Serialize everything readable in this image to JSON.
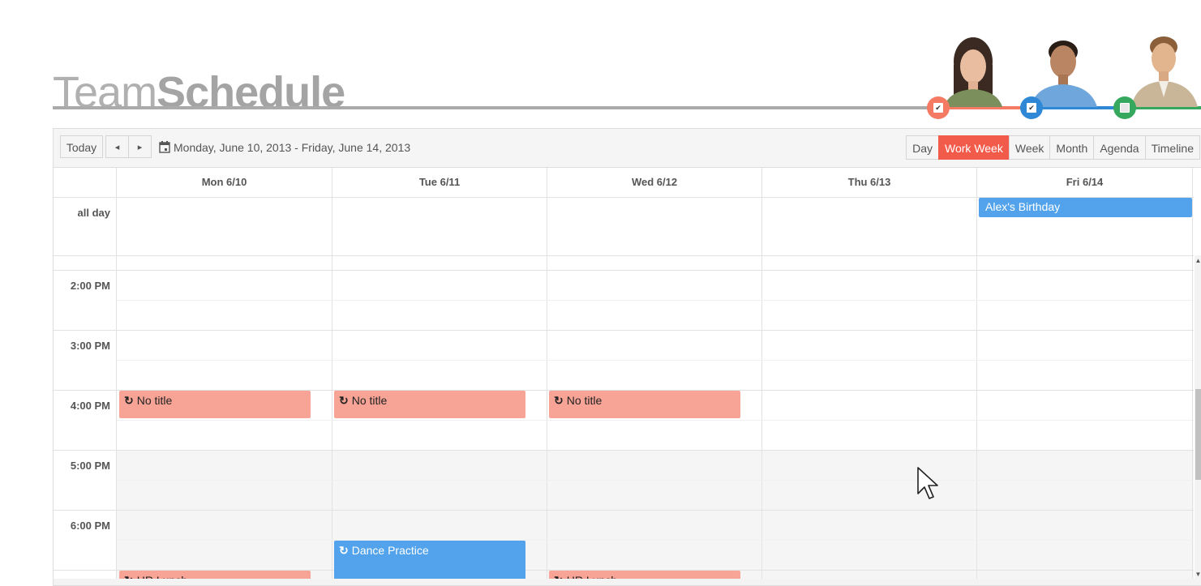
{
  "header": {
    "title_light": "Team",
    "title_bold": "Schedule"
  },
  "people": [
    {
      "name": "woman",
      "color": "#f47a64",
      "checked": true,
      "check_glyph": "✔"
    },
    {
      "name": "man-blue-shirt",
      "color": "#2f88d6",
      "checked": true,
      "check_glyph": "✔"
    },
    {
      "name": "man-suit",
      "color": "#35a85d",
      "checked": false,
      "check_glyph": ""
    }
  ],
  "toolbar": {
    "today_label": "Today",
    "prev_icon": "◂",
    "next_icon": "▸",
    "calendar_icon": "calendar-icon",
    "date_range": "Monday, June 10, 2013 - Friday, June 14, 2013",
    "views": [
      {
        "label": "Day",
        "active": false
      },
      {
        "label": "Work Week",
        "active": true
      },
      {
        "label": "Week",
        "active": false
      },
      {
        "label": "Month",
        "active": false
      },
      {
        "label": "Agenda",
        "active": false
      },
      {
        "label": "Timeline",
        "active": false
      }
    ]
  },
  "days": [
    "Mon 6/10",
    "Tue 6/11",
    "Wed 6/12",
    "Thu 6/13",
    "Fri 6/14"
  ],
  "allday_label": "all day",
  "times": [
    "2:00 PM",
    "3:00 PM",
    "4:00 PM",
    "5:00 PM",
    "6:00 PM"
  ],
  "allday_events": [
    {
      "title": "Alex's Birthday",
      "day": "Fri 6/14",
      "color": "blue"
    }
  ],
  "events": [
    {
      "title": "No title",
      "day": "Mon 6/10",
      "recurring": true,
      "color": "red",
      "start": "4:00 PM",
      "end": "4:30 PM"
    },
    {
      "title": "No title",
      "day": "Tue 6/11",
      "recurring": true,
      "color": "red",
      "start": "4:00 PM",
      "end": "4:30 PM"
    },
    {
      "title": "No title",
      "day": "Wed 6/12",
      "recurring": true,
      "color": "red",
      "start": "4:00 PM",
      "end": "4:30 PM"
    },
    {
      "title": "Dance Practice",
      "day": "Tue 6/11",
      "recurring": true,
      "color": "blue",
      "start": "6:30 PM",
      "end": "7:00 PM"
    },
    {
      "title": "HR Lunch",
      "day": "Mon 6/10",
      "recurring": true,
      "color": "red",
      "start": "7:00 PM",
      "end": "7:30 PM"
    },
    {
      "title": "HR Lunch",
      "day": "Wed 6/12",
      "recurring": true,
      "color": "red",
      "start": "7:00 PM",
      "end": "7:30 PM"
    }
  ],
  "colors": {
    "accent": "#f25a4a",
    "event_red": "#f7a396",
    "event_blue": "#52a3ec"
  }
}
